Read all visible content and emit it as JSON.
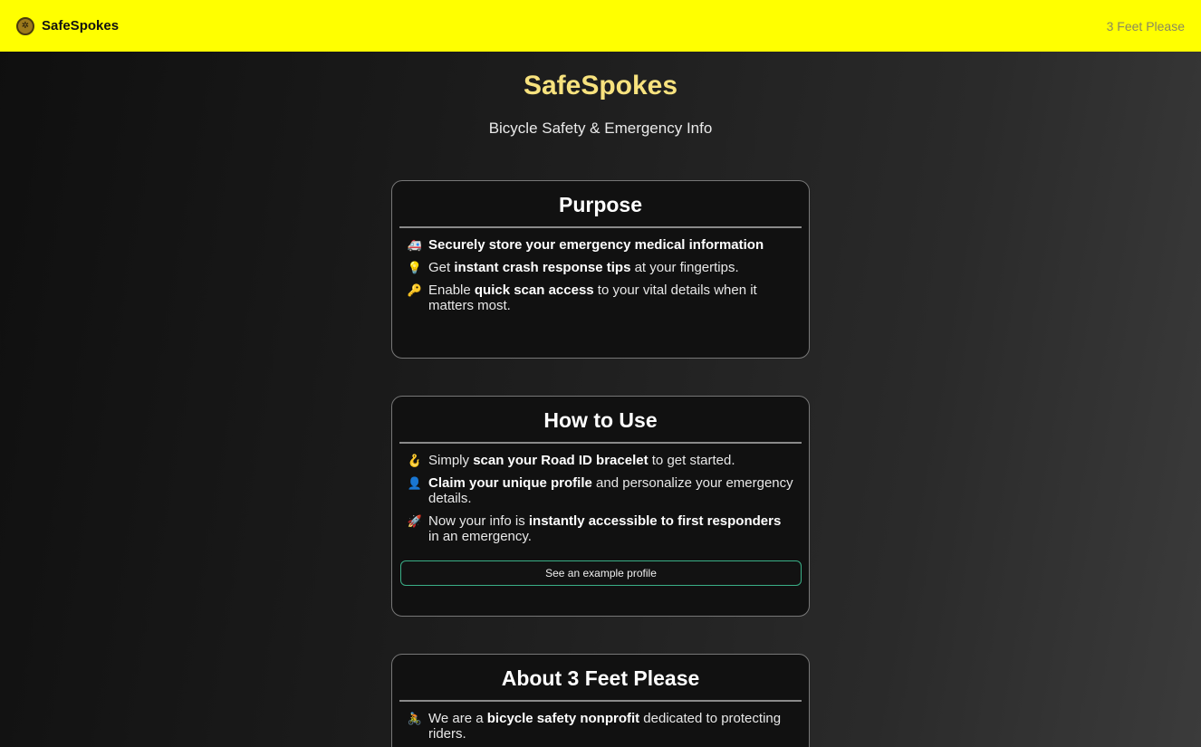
{
  "header": {
    "brand": "SafeSpokes",
    "logo_icon": "bicycle-logo-icon",
    "nav_link": "3 Feet Please",
    "bg_color": "#ffff00"
  },
  "hero": {
    "title": "SafeSpokes",
    "subtitle": "Bicycle Safety & Emergency Info",
    "title_color": "#f7e27e"
  },
  "purpose": {
    "title": "Purpose",
    "items": [
      {
        "icon": "ambulance-icon",
        "glyph": "🚑",
        "pre": "",
        "bold": "Securely store your emergency medical information",
        "post": ""
      },
      {
        "icon": "lightbulb-icon",
        "glyph": "💡",
        "pre": "Get ",
        "bold": "instant crash response tips",
        "post": " at your fingertips."
      },
      {
        "icon": "key-icon",
        "glyph": "🔑",
        "pre": "Enable ",
        "bold": "quick scan access",
        "post": " to your vital details when it matters most."
      }
    ]
  },
  "how_to_use": {
    "title": "How to Use",
    "items": [
      {
        "icon": "hook-icon",
        "glyph": "🪝",
        "pre": "Simply ",
        "bold": "scan your Road ID bracelet",
        "post": " to get started."
      },
      {
        "icon": "person-icon",
        "glyph": "👤",
        "pre": "",
        "bold": "Claim your unique profile",
        "post": " and personalize your emergency details."
      },
      {
        "icon": "rocket-icon",
        "glyph": "🚀",
        "pre": "Now your info is ",
        "bold": "instantly accessible to first responders",
        "post": " in an emergency."
      }
    ],
    "button_label": "See an example profile"
  },
  "about": {
    "title": "About 3 Feet Please",
    "items": [
      {
        "icon": "cyclist-icon",
        "glyph": "🚴",
        "pre": "We are a ",
        "bold": "bicycle safety nonprofit",
        "post": " dedicated to protecting riders."
      }
    ]
  }
}
